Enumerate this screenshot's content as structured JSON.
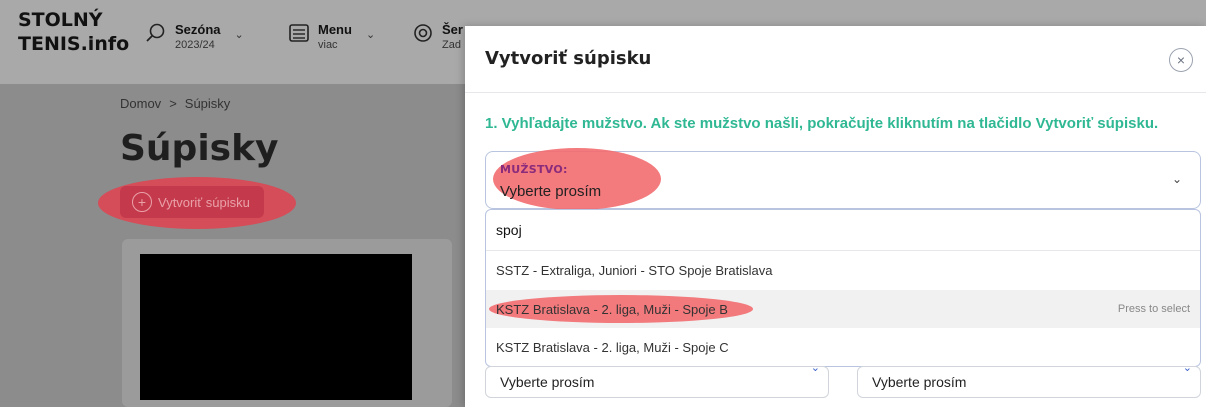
{
  "site": {
    "logo_line1": "STOLNÝ",
    "logo_line2": "TENIS.info"
  },
  "nav": [
    {
      "title": "Sezóna",
      "sub": "2023/24",
      "icon": "search-icon"
    },
    {
      "title": "Menu",
      "sub": "viac",
      "icon": "list-icon"
    },
    {
      "title": "Šer",
      "sub": "Zad",
      "icon": "target-icon"
    }
  ],
  "page": {
    "breadcrumb_home": "Domov",
    "breadcrumb_sep": ">",
    "breadcrumb_current": "Súpisky",
    "title": "Súpisky",
    "create_button": "Vytvoriť súpisku"
  },
  "modal": {
    "title": "Vytvoriť súpisku",
    "close": "×",
    "step_text": "1. Vyhľadajte mužstvo. Ak ste mužstvo našli, pokračujte kliknutím na tlačidlo Vytvoriť súpisku.",
    "select_label": "MUŽSTVO:",
    "select_value": "Vyberte prosím",
    "search_value": "spoj",
    "options": [
      "SSTZ - Extraliga, Juniori - STO Spoje Bratislava",
      "KSTZ Bratislava - 2. liga, Muži - Spoje B",
      "KSTZ Bratislava - 2. liga, Muži - Spoje C"
    ],
    "press_hint": "Press to select",
    "lower_left_value": "Vyberte prosím",
    "lower_right_value": "Vyberte prosím"
  },
  "colors": {
    "accent_green": "#2fb893",
    "label_purple": "#8a2b7c",
    "highlight_red": "#f26b6f"
  }
}
